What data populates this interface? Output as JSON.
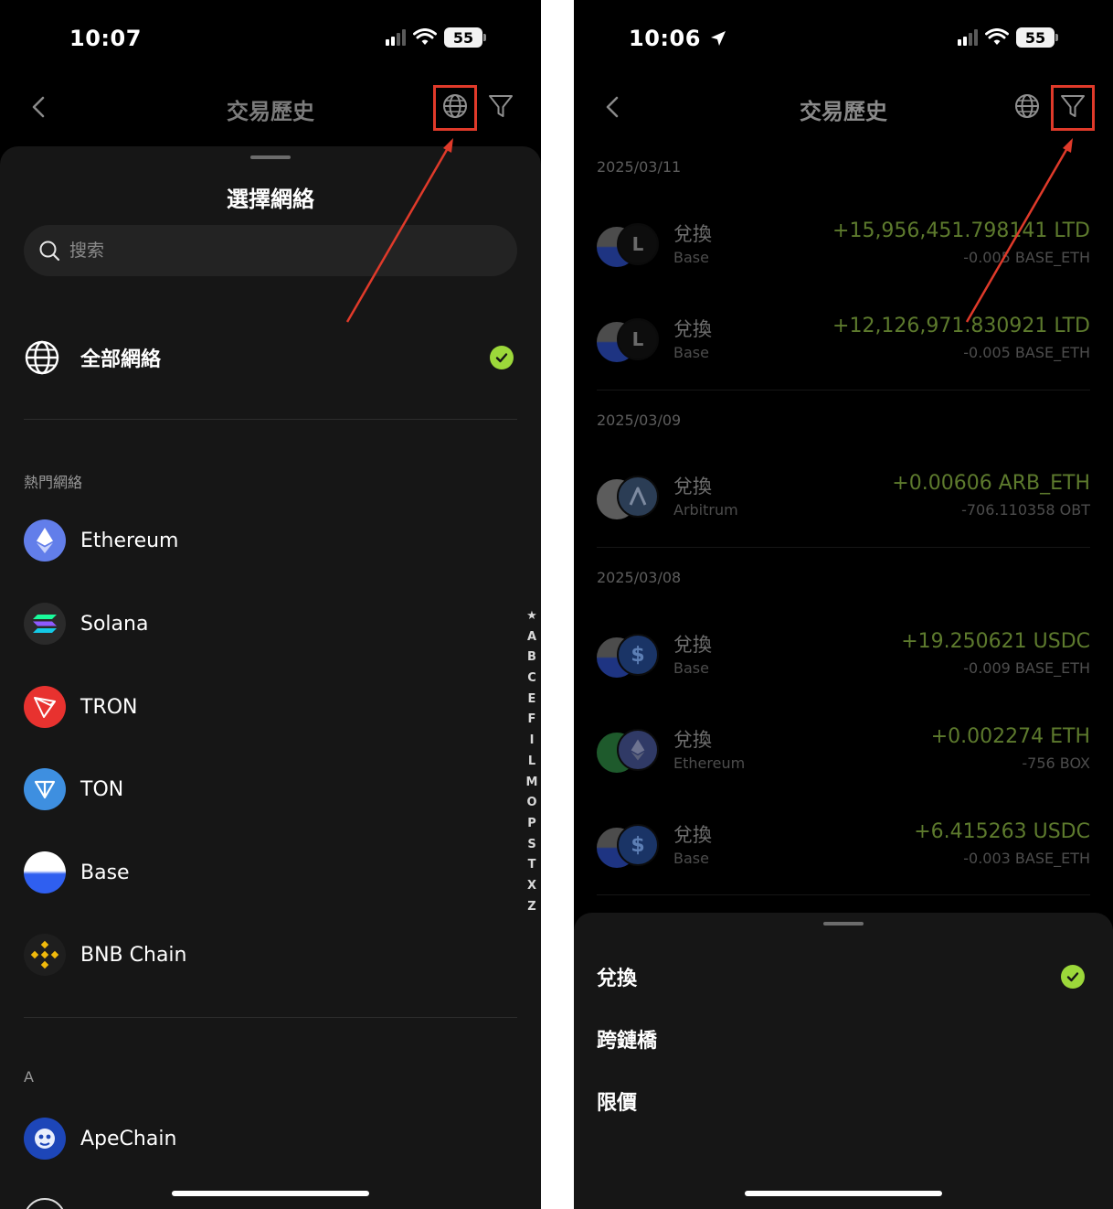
{
  "left": {
    "status": {
      "time": "10:07",
      "battery": "55"
    },
    "header": {
      "title": "交易歷史"
    },
    "sheet": {
      "title": "選擇網絡",
      "search_placeholder": "搜索",
      "all_networks": "全部網絡",
      "popular_label": "熱門網絡",
      "popular": [
        {
          "name": "Ethereum",
          "icon": "ethereum-icon"
        },
        {
          "name": "Solana",
          "icon": "solana-icon"
        },
        {
          "name": "TRON",
          "icon": "tron-icon"
        },
        {
          "name": "TON",
          "icon": "ton-icon"
        },
        {
          "name": "Base",
          "icon": "base-icon"
        },
        {
          "name": "BNB Chain",
          "icon": "bnb-icon"
        }
      ],
      "section_a": "A",
      "a_items": [
        {
          "name": "ApeChain",
          "icon": "apechain-icon"
        }
      ],
      "alpha_index": [
        "★",
        "A",
        "B",
        "C",
        "E",
        "F",
        "I",
        "L",
        "M",
        "O",
        "P",
        "S",
        "T",
        "X",
        "Z"
      ]
    }
  },
  "right": {
    "status": {
      "time": "10:06",
      "battery": "55"
    },
    "header": {
      "title": "交易歷史"
    },
    "groups": [
      {
        "date": "2025/03/11",
        "items": [
          {
            "type": "兌換",
            "network": "Base",
            "amount": "+15,956,451.798141 LTD",
            "sub": "-0.005 BASE_ETH",
            "front_icon": "L"
          },
          {
            "type": "兌換",
            "network": "Base",
            "amount": "+12,126,971.830921 LTD",
            "sub": "-0.005 BASE_ETH",
            "front_icon": "L"
          }
        ]
      },
      {
        "date": "2025/03/09",
        "items": [
          {
            "type": "兌換",
            "network": "Arbitrum",
            "amount": "+0.00606 ARB_ETH",
            "sub": "-706.110358 OBT",
            "front_icon": ""
          }
        ]
      },
      {
        "date": "2025/03/08",
        "items": [
          {
            "type": "兌換",
            "network": "Base",
            "amount": "+19.250621 USDC",
            "sub": "-0.009 BASE_ETH",
            "front_icon": "$"
          },
          {
            "type": "兌換",
            "network": "Ethereum",
            "amount": "+0.002274 ETH",
            "sub": "-756 BOX",
            "front_icon": ""
          },
          {
            "type": "兌換",
            "network": "Base",
            "amount": "+6.415263 USDC",
            "sub": "-0.003 BASE_ETH",
            "front_icon": "$"
          }
        ]
      }
    ],
    "filter_options": [
      {
        "label": "兌換",
        "selected": true
      },
      {
        "label": "跨鏈橋",
        "selected": false
      },
      {
        "label": "限價",
        "selected": false
      }
    ]
  },
  "colors": {
    "accent_check": "#9cd83a",
    "highlight_red": "#e03a2a",
    "amount_green": "#5d7a2d"
  }
}
